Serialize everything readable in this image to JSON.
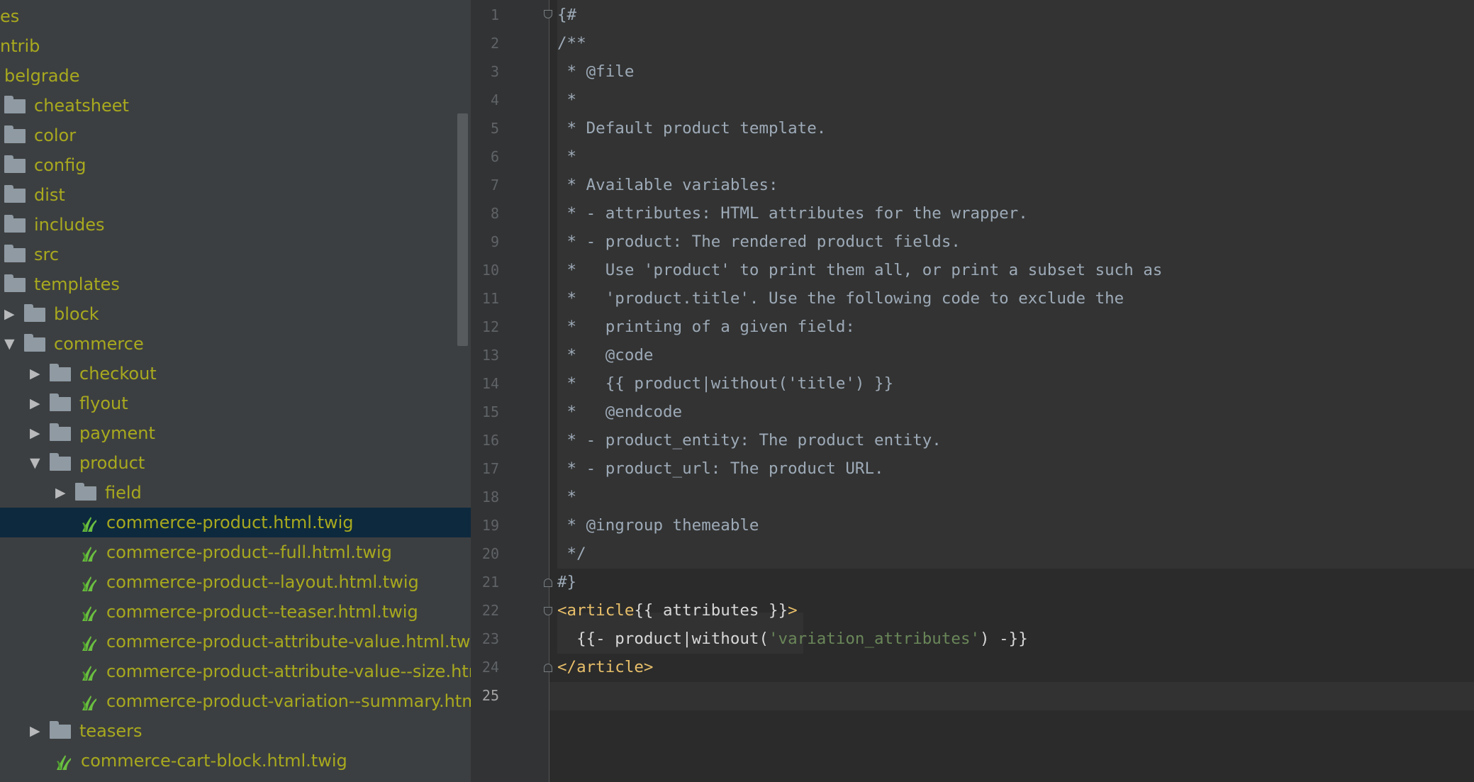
{
  "tree": {
    "items": [
      {
        "label": "es",
        "type": "text",
        "indent": 0
      },
      {
        "label": "ntrib",
        "type": "text",
        "indent": 0
      },
      {
        "label": "belgrade",
        "type": "text",
        "indent": 1
      },
      {
        "label": "cheatsheet",
        "type": "folder",
        "indent": 1
      },
      {
        "label": "color",
        "type": "folder",
        "indent": 1
      },
      {
        "label": "config",
        "type": "folder",
        "indent": 1
      },
      {
        "label": "dist",
        "type": "folder",
        "indent": 1
      },
      {
        "label": "includes",
        "type": "folder",
        "indent": 1
      },
      {
        "label": "src",
        "type": "folder",
        "indent": 1
      },
      {
        "label": "templates",
        "type": "folder",
        "indent": 1
      },
      {
        "label": "block",
        "type": "folder",
        "indent": 2,
        "arrow": "right"
      },
      {
        "label": "commerce",
        "type": "folder",
        "indent": 2,
        "arrow": "down"
      },
      {
        "label": "checkout",
        "type": "folder",
        "indent": 3,
        "arrow": "right"
      },
      {
        "label": "flyout",
        "type": "folder",
        "indent": 3,
        "arrow": "right"
      },
      {
        "label": "payment",
        "type": "folder",
        "indent": 3,
        "arrow": "right"
      },
      {
        "label": "product",
        "type": "folder",
        "indent": 3,
        "arrow": "down"
      },
      {
        "label": "field",
        "type": "folder",
        "indent": 4,
        "arrow": "right"
      },
      {
        "label": "commerce-product.html.twig",
        "type": "twig",
        "indent": 4,
        "selected": true
      },
      {
        "label": "commerce-product--full.html.twig",
        "type": "twig",
        "indent": 4
      },
      {
        "label": "commerce-product--layout.html.twig",
        "type": "twig",
        "indent": 4
      },
      {
        "label": "commerce-product--teaser.html.twig",
        "type": "twig",
        "indent": 4
      },
      {
        "label": "commerce-product-attribute-value.html.twig",
        "type": "twig",
        "indent": 4
      },
      {
        "label": "commerce-product-attribute-value--size.htm",
        "type": "twig",
        "indent": 4
      },
      {
        "label": "commerce-product-variation--summary.html",
        "type": "twig",
        "indent": 4
      },
      {
        "label": "teasers",
        "type": "folder",
        "indent": 3,
        "arrow": "right"
      },
      {
        "label": "commerce-cart-block.html.twig",
        "type": "twig",
        "indent": 3
      }
    ],
    "icons": {
      "folder": "folder-icon",
      "twig": "twig-file-icon",
      "expand": "chevron-right-icon",
      "collapse": "chevron-down-icon"
    },
    "colors": {
      "label": "#a8a91e",
      "background": "#3c3f41",
      "selected": "#0d293e"
    }
  },
  "editor": {
    "current_line": 25,
    "lines": [
      "{#",
      "/**",
      " * @file",
      " *",
      " * Default product template.",
      " *",
      " * Available variables:",
      " * - attributes: HTML attributes for the wrapper.",
      " * - product: The rendered product fields.",
      " *   Use 'product' to print them all, or print a subset such as",
      " *   'product.title'. Use the following code to exclude the",
      " *   printing of a given field:",
      " *   @code",
      " *   {{ product|without('title') }}",
      " *   @endcode",
      " * - product_entity: The product entity.",
      " * - product_url: The product URL.",
      " *",
      " * @ingroup themeable",
      " */",
      "#}",
      "<article{{ attributes }}>",
      "  {{- product|without('variation_attributes') -}}",
      "</article>",
      ""
    ],
    "tokens": {
      "l22_tag_open": "<article",
      "l22_expr": "{{ attributes }}",
      "l22_tag_close": ">",
      "l23_pre": "  {{- product|without(",
      "l23_str": "'variation_attributes'",
      "l23_post": ") -}}",
      "l24_tag": "</article>"
    },
    "colors": {
      "text": "#a9b7c6",
      "tag": "#e8bf6a",
      "string": "#6a8759",
      "gutter": "#313335",
      "background": "#2b2b2b"
    }
  }
}
